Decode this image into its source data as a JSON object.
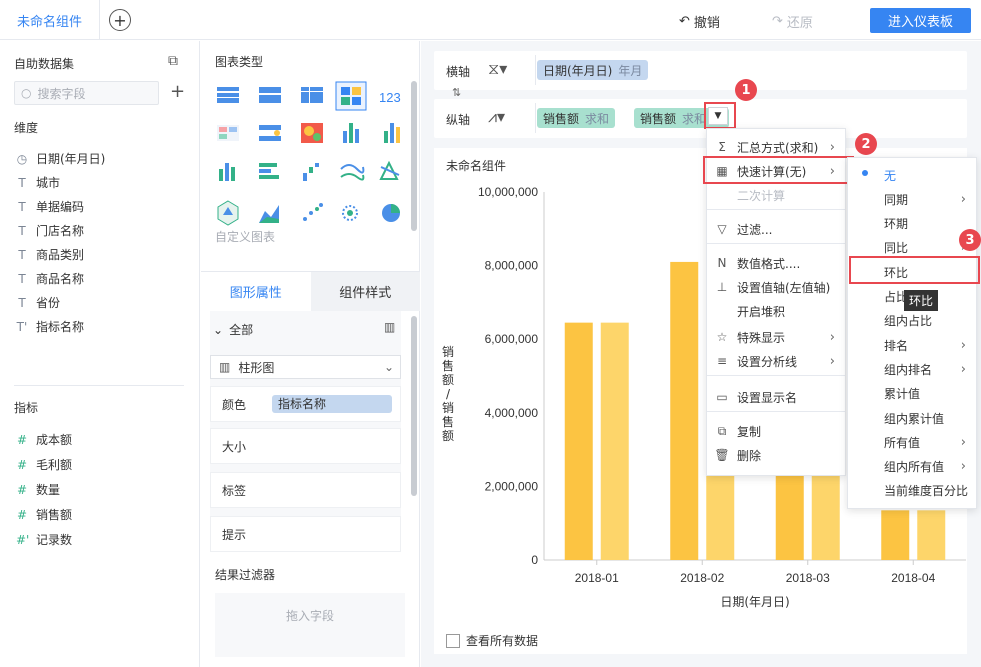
{
  "topbar": {
    "tab": "未命名组件",
    "undo": "撤销",
    "redo": "还原",
    "enter": "进入仪表板"
  },
  "left": {
    "dataset": "自助数据集",
    "search_placeholder": "搜索字段",
    "dim_title": "维度",
    "dims": [
      {
        "icon": "◷",
        "label": "日期(年月日)"
      },
      {
        "icon": "T",
        "label": "城市"
      },
      {
        "icon": "T",
        "label": "单据编码"
      },
      {
        "icon": "T",
        "label": "门店名称"
      },
      {
        "icon": "T",
        "label": "商品类别"
      },
      {
        "icon": "T",
        "label": "商品名称"
      },
      {
        "icon": "T",
        "label": "省份"
      },
      {
        "icon": "T'",
        "label": "指标名称"
      }
    ],
    "measure_title": "指标",
    "measures": [
      {
        "icon": "#",
        "label": "成本额"
      },
      {
        "icon": "#",
        "label": "毛利额"
      },
      {
        "icon": "#",
        "label": "数量"
      },
      {
        "icon": "#",
        "label": "销售额"
      },
      {
        "icon": "#'",
        "label": "记录数"
      }
    ]
  },
  "mid": {
    "chart_type_title": "图表类型",
    "custom": "自定义图表",
    "tab_props": "图形属性",
    "tab_style": "组件样式",
    "all": "全部",
    "chart_select": "柱形图",
    "color": "颜色",
    "color_field": "指标名称",
    "size": "大小",
    "label": "标签",
    "tip": "提示",
    "filter_title": "结果过滤器",
    "drop_hint": "拖入字段"
  },
  "axes": {
    "x_label": "横轴",
    "x_pill_name": "日期(年月日)",
    "x_pill_sub": "年月",
    "y_label": "纵轴",
    "y_pill1_name": "销售额",
    "y_pill1_sub": "求和",
    "y_pill2_name": "销售额",
    "y_pill2_sub": "求和"
  },
  "chart_panel": {
    "title": "未命名组件",
    "show_all": "查看所有数据"
  },
  "chart_data": {
    "type": "bar",
    "categories": [
      "2018-01",
      "2018-02",
      "2018-03",
      "2018-04"
    ],
    "series": [
      {
        "values": [
          6450000,
          8100000,
          6600000,
          1350000
        ]
      },
      {
        "values": [
          6450000,
          8100000,
          6600000,
          1350000
        ]
      }
    ],
    "yticks": [
      "10,000,000",
      "8,000,000",
      "6,000,000",
      "4,000,000",
      "2,000,000",
      "0"
    ],
    "ylim": [
      0,
      10000000
    ],
    "xlabel": "日期(年月日)",
    "ylabel": "销售额/销售额",
    "colors": [
      "#fcc442",
      "#fdd56a"
    ]
  },
  "menu1": [
    {
      "icon": "Σ",
      "label": "汇总方式(求和)",
      "arrow": true
    },
    {
      "icon": "▦",
      "label": "快速计算(无)",
      "arrow": true
    },
    {
      "icon": "",
      "label": "二次计算",
      "disabled": true
    },
    {
      "icon": "▽",
      "label": "过滤..."
    },
    {
      "icon": "N",
      "label": "数值格式...."
    },
    {
      "icon": "⊥",
      "label": "设置值轴(左值轴)"
    },
    {
      "icon": "",
      "label": "开启堆积"
    },
    {
      "icon": "☆",
      "label": "特殊显示",
      "arrow": true
    },
    {
      "icon": "≡",
      "label": "设置分析线",
      "arrow": true
    },
    {
      "icon": "▭",
      "label": "设置显示名"
    },
    {
      "icon": "⧉",
      "label": "复制"
    },
    {
      "icon": "🗑",
      "label": "删除"
    }
  ],
  "menu2": [
    {
      "label": "无",
      "active": true
    },
    {
      "label": "同期",
      "arrow": true
    },
    {
      "label": "环期"
    },
    {
      "label": "同比",
      "arrow": true
    },
    {
      "label": "环比"
    },
    {
      "label": "占比"
    },
    {
      "label": "组内占比"
    },
    {
      "label": "排名",
      "arrow": true
    },
    {
      "label": "组内排名",
      "arrow": true
    },
    {
      "label": "累计值"
    },
    {
      "label": "组内累计值"
    },
    {
      "label": "所有值",
      "arrow": true
    },
    {
      "label": "组内所有值",
      "arrow": true
    },
    {
      "label": "当前维度百分比"
    }
  ],
  "tooltip": "环比",
  "badges": [
    "1",
    "2",
    "3"
  ]
}
